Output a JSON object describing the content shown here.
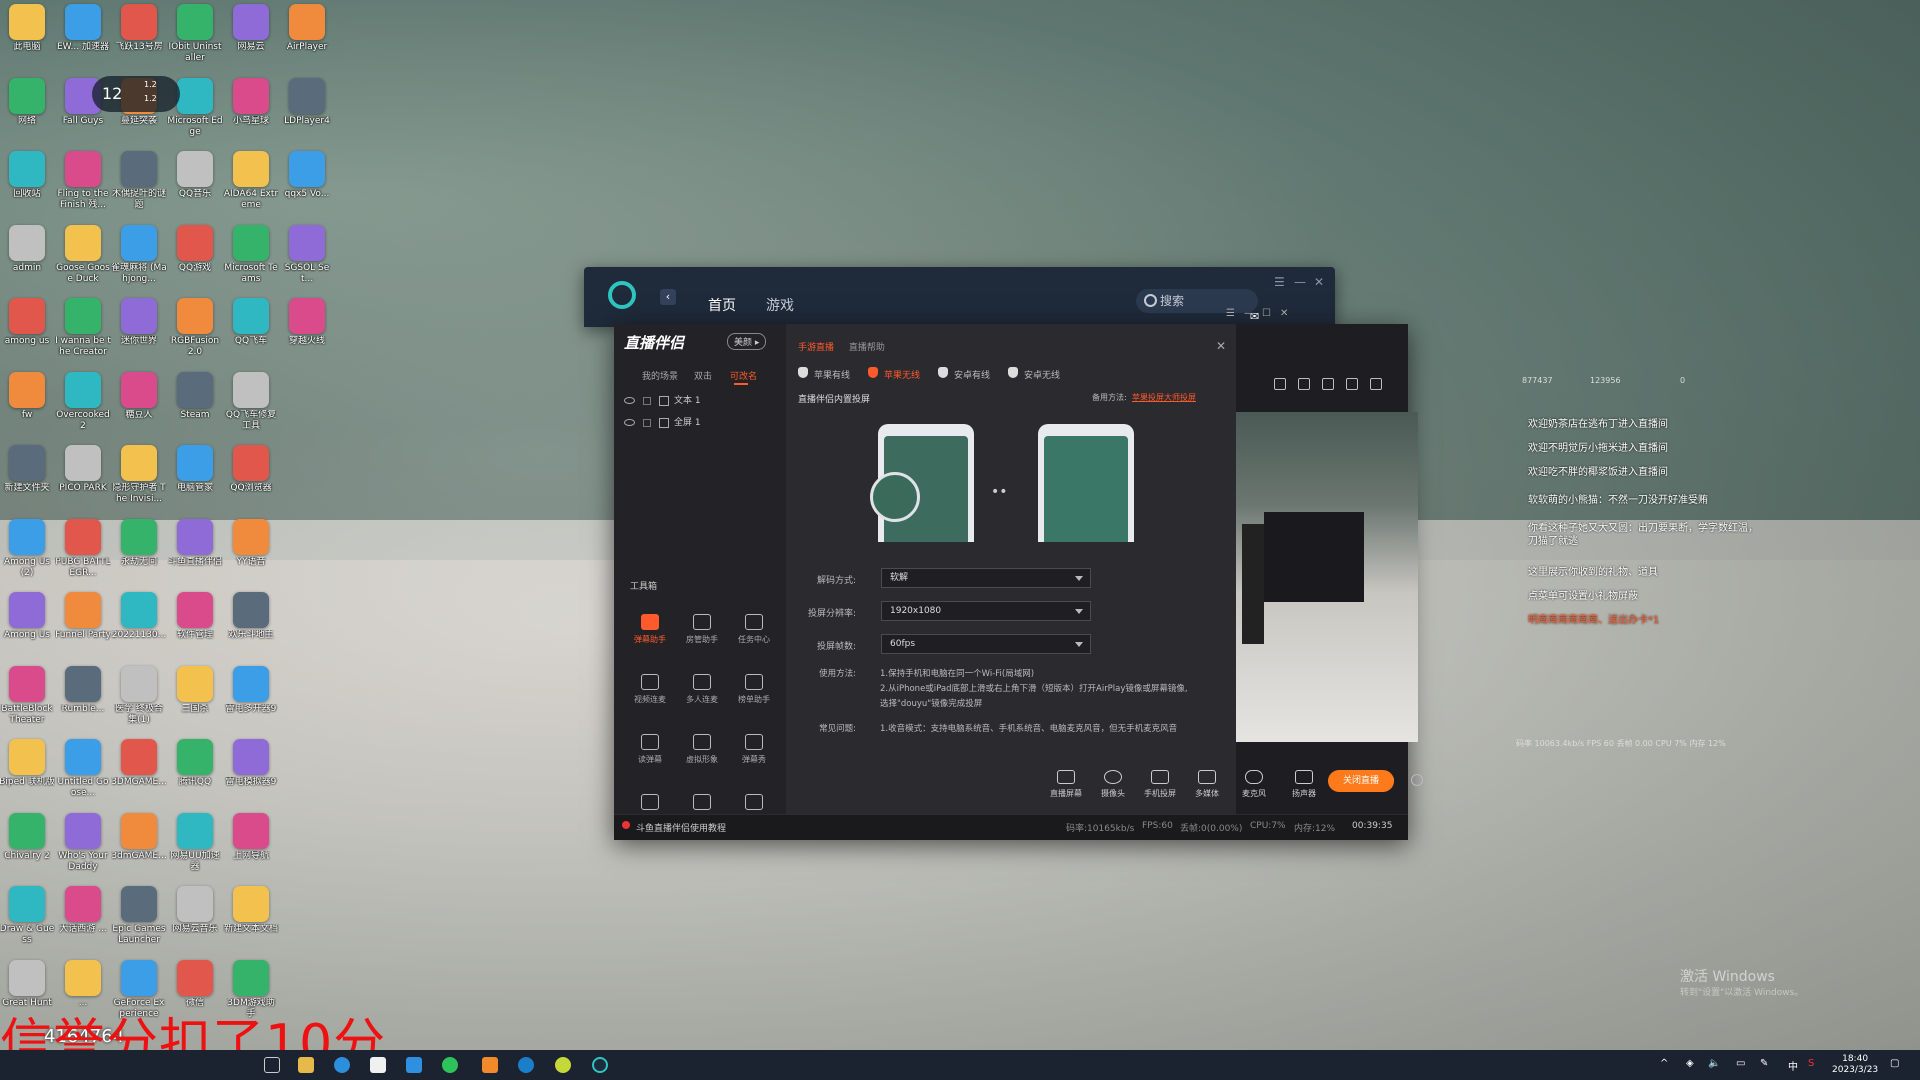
{
  "desktop": {
    "icons": [
      [
        "此电脑",
        "EW... 加速器",
        "飞跃13号房",
        "IObit Uninstaller",
        "网易云",
        "AirPlayer"
      ],
      [
        "网络",
        "Fall Guys",
        "蔓延突袭",
        "Microsoft Edge",
        "小鸟星球",
        "LDPlayer4"
      ],
      [
        "回收站",
        "Fling to the Finish 残...",
        "木偶捉叶的谜题",
        "QQ音乐",
        "AIDA64 Extreme",
        "qqx5 Vo..."
      ],
      [
        "admin",
        "Goose Goose Duck",
        "雀魂麻将 (Mahjong...",
        "QQ游戏",
        "Microsoft Teams",
        "SGSOL Set..."
      ],
      [
        "among us",
        "I wanna be the Creator",
        "迷你世界",
        "RGBFusion 2.0",
        "QQ飞车",
        "穿越火线"
      ],
      [
        "fw",
        "Overcooked 2",
        "糖豆人",
        "Steam",
        "QQ飞车修复工具",
        ""
      ],
      [
        "新建文件夹",
        "PICO PARK",
        "隐形守护者 The Invisi...",
        "电脑管家",
        "QQ浏览器",
        ""
      ],
      [
        "Among Us (2)",
        "PUBG BATTLEGR...",
        "永劫无间",
        "斗鱼直播伴侣",
        "YY语音",
        ""
      ],
      [
        "Among Us",
        "Funnel Party",
        "20221130...",
        "软件管理",
        "欢乐斗地主",
        ""
      ],
      [
        "BattleBlock Theater",
        "Rumble...",
        "医学 终极合集(1)",
        "三国杀",
        "雷电多开器9",
        ""
      ],
      [
        "Biped 联机版",
        "Untitled Goose...",
        "3DMGAME...",
        "腾讯QQ",
        "雷电模拟器9",
        ""
      ],
      [
        "Chivalry 2",
        "Who's Your Daddy",
        "3dmGAME...",
        "网易UU加速器",
        "上网导航",
        ""
      ],
      [
        "Draw & Guess",
        "大话西游 ...",
        "Epic Games Launcher",
        "网易云音乐",
        "新建文本文档",
        ""
      ],
      [
        "Great Hunt",
        "...",
        "GeForce Experience",
        "微信",
        "3DM游戏助手",
        ""
      ]
    ],
    "widget": {
      "value": "12",
      "up": "1.2",
      "down": "1.2"
    }
  },
  "launcher": {
    "tabs": [
      "首页",
      "游戏"
    ],
    "search_placeholder": "搜索"
  },
  "app": {
    "brand": "直播伴侣",
    "brand_badge": "美颜 ▸",
    "scene_tabs": [
      "我的场景",
      "双击",
      "可改名"
    ],
    "scenes": [
      "文本 1",
      "全屏 1"
    ],
    "toolbox_title": "工具箱",
    "tools": [
      [
        "弹幕助手",
        "房管助手",
        "任务中心"
      ],
      [
        "视频连麦",
        "多人连麦",
        "榜单助手"
      ],
      [
        "读弹幕",
        "虚拟形象",
        "弹幕秀"
      ],
      [
        "",
        "",
        ""
      ]
    ],
    "center_tabs": [
      "手游直播",
      "直播帮助"
    ],
    "platform_tabs": [
      "苹果有线",
      "苹果无线",
      "安卓有线",
      "安卓无线"
    ],
    "projection_title": "直播伴侣内置投屏",
    "backup_label": "备用方法:",
    "backup_link": "苹果投屏大师投屏",
    "fields": [
      {
        "label": "解码方式:",
        "value": "软解"
      },
      {
        "label": "投屏分辨率:",
        "value": "1920x1080"
      },
      {
        "label": "投屏帧数:",
        "value": "60fps"
      }
    ],
    "usage_label": "使用方法:",
    "usage_lines": [
      "1.保持手机和电脑在同一个Wi-Fi(局域网)",
      "2.从iPhone或iPad底部上滑或右上角下滑（短版本）打开AirPlay镜像或屏幕镜像,",
      "选择\"douyu\"镜像完成投屏"
    ],
    "faq_label": "常见问题:",
    "faq_text": "1.收音模式：支持电脑系统音、手机系统音、电脑麦克风音，但无手机麦克风音",
    "bottom_items": [
      "直播屏幕",
      "摄像头",
      "手机投屏",
      "多媒体",
      "麦克风",
      "扬声器"
    ],
    "live_button": "关闭直播",
    "status": {
      "tutorial": "斗鱼直播伴侣使用教程",
      "bitrate": "码率:10165kb/s",
      "fps": "FPS:60",
      "dropped": "丢帧:0(0.00%)",
      "cpu": "CPU:7%",
      "mem": "内存:12%",
      "time": "00:39:35"
    }
  },
  "overlay": {
    "stats": [
      "877437",
      "123956",
      "0"
    ],
    "chat": [
      "欢迎奶茶店在逃布丁进入直播间",
      "欢迎不明觉厉小拖米进入直播间",
      "欢迎吃不胖的椰浆饭进入直播间",
      "软软萌的小熊猫：不然一刀没开好准受贿",
      "你看这种子她又大又圆：出刀要果断，学字数红温，刀猫了就逃",
      "这里展示你收到的礼物、道具",
      "点菜单可设置小礼物屏蔽"
    ],
    "gift": "明南南南南南南、送出办卡*1",
    "perf": "码率 10063.4kb/s FPS 60 丢帧 0.00 CPU 7% 内存 12%"
  },
  "big_text": "信誉分扣了10分",
  "counter": "4164764",
  "watermark": {
    "line1": "激活 Windows",
    "line2": "转到\"设置\"以激活 Windows。"
  },
  "clock": {
    "time": "18:40",
    "date": "2023/3/23"
  },
  "colors": {
    "accent": "#ff5a2c",
    "live": "#ff7a1a",
    "cyan": "#2ec5c0"
  }
}
